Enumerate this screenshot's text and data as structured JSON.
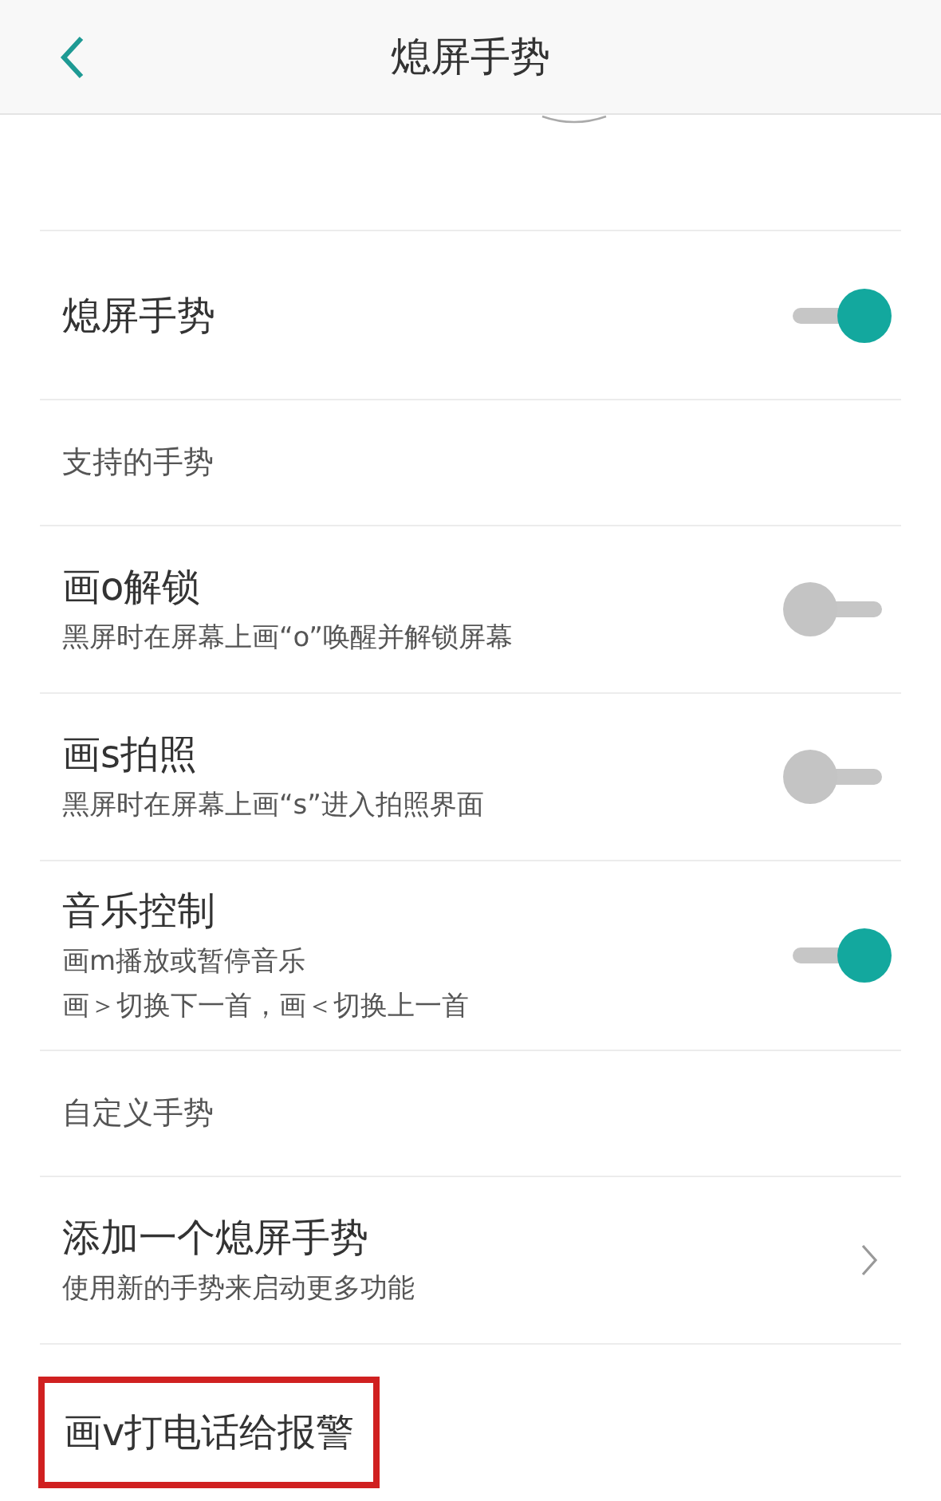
{
  "header": {
    "title": "熄屏手势"
  },
  "master": {
    "title": "熄屏手势",
    "on": true
  },
  "sections": [
    {
      "heading": "支持的手势",
      "items": [
        {
          "kind": "toggle",
          "title": "画o解锁",
          "lines": [
            "黑屏时在屏幕上画“o”唤醒并解锁屏幕"
          ],
          "on": false
        },
        {
          "kind": "toggle",
          "title": "画s拍照",
          "lines": [
            "黑屏时在屏幕上画“s”进入拍照界面"
          ],
          "on": false
        },
        {
          "kind": "toggle",
          "title": "音乐控制",
          "lines": [
            "画m播放或暂停音乐",
            "画＞切换下一首，画＜切换上一首"
          ],
          "on": true
        }
      ]
    },
    {
      "heading": "自定义手势",
      "items": [
        {
          "kind": "link",
          "title": "添加一个熄屏手势",
          "lines": [
            "使用新的手势来启动更多功能"
          ]
        },
        {
          "kind": "plain",
          "title": "画v打电话给报警",
          "highlighted": true
        }
      ]
    }
  ]
}
